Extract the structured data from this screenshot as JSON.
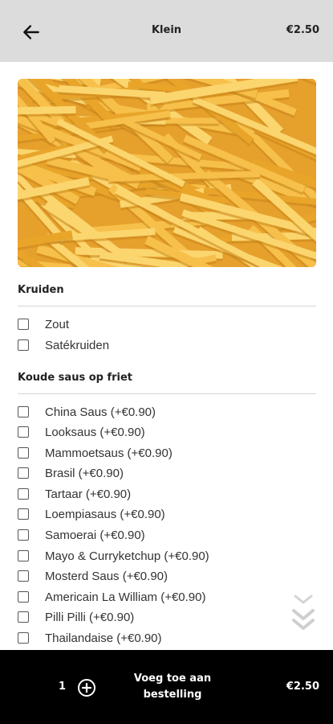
{
  "header": {
    "title": "Klein",
    "price": "€2.50",
    "back_icon": "arrow-left-icon"
  },
  "image": {
    "description_icon": "fries-image",
    "colors": [
      "#f6c04a",
      "#e9a52a",
      "#fbd56e",
      "#c9861a"
    ]
  },
  "sections": [
    {
      "title": "Kruiden",
      "options": [
        {
          "label": "Zout",
          "checked": false
        },
        {
          "label": "Satékruiden",
          "checked": false
        }
      ]
    },
    {
      "title": "Koude saus op friet",
      "options": [
        {
          "label": "China Saus (+€0.90)",
          "checked": false
        },
        {
          "label": "Looksaus (+€0.90)",
          "checked": false
        },
        {
          "label": "Mammoetsaus (+€0.90)",
          "checked": false
        },
        {
          "label": "Brasil (+€0.90)",
          "checked": false
        },
        {
          "label": "Tartaar (+€0.90)",
          "checked": false
        },
        {
          "label": "Loempiasaus (+€0.90)",
          "checked": false
        },
        {
          "label": "Samoerai (+€0.90)",
          "checked": false
        },
        {
          "label": "Mayo & Curryketchup (+€0.90)",
          "checked": false
        },
        {
          "label": "Mosterd Saus (+€0.90)",
          "checked": false
        },
        {
          "label": "Americain La William (+€0.90)",
          "checked": false
        },
        {
          "label": "Pilli Pilli (+€0.90)",
          "checked": false
        },
        {
          "label": "Thailandaise (+€0.90)",
          "checked": false
        }
      ]
    }
  ],
  "footer": {
    "quantity": "1",
    "add_label_line1": "Voeg toe aan",
    "add_label_line2": "bestelling",
    "total": "€2.50",
    "plus_icon": "plus-circle-icon"
  },
  "scroll_hint_icon": "double-chevron-down-icon"
}
